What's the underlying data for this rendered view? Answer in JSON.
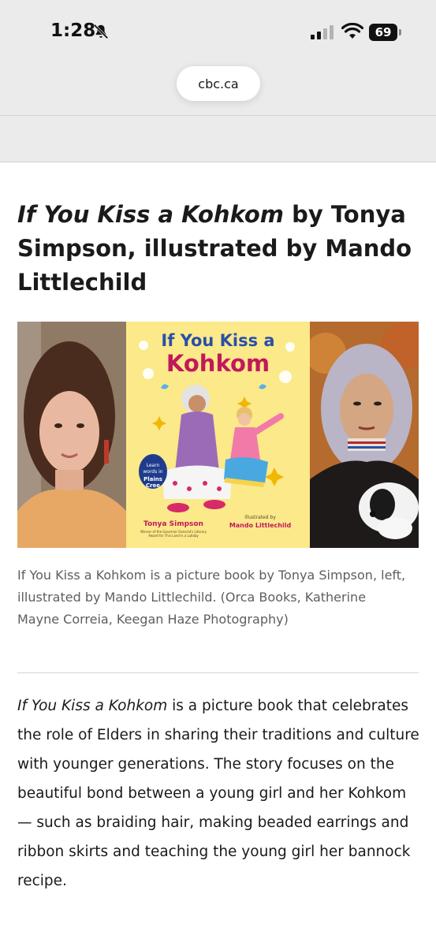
{
  "status_bar": {
    "time": "1:28",
    "battery_level": "69",
    "icons": [
      "bell-slash-icon",
      "cellular-signal-icon",
      "wifi-icon",
      "battery-icon"
    ]
  },
  "browser": {
    "url": "cbc.ca"
  },
  "article": {
    "headline_italic": "If You Kiss a Kohkom",
    "headline_rest": " by Tonya Simpson, illustrated by Mando Littlechild",
    "image": {
      "cover_title_line1": "If You Kiss a",
      "cover_title_line2": "Kohkom",
      "cover_badge": "Learn words in Plains Cree",
      "cover_author": "Tonya Simpson",
      "cover_author_note": "Winner of the Governor General's Literary Award for This Land Is a Lullaby",
      "cover_illustrator_label": "illustrated by",
      "cover_illustrator": "Mando Littlechild"
    },
    "caption": "If You Kiss a Kohkom is a picture book by Tonya Simpson, left, illustrated by Mando Littlechild. (Orca Books, Katherine Mayne Correia, Keegan Haze Photography)",
    "body_italic": "If You Kiss a Kohkom",
    "body_rest": " is a picture book that celebrates the role of Elders in sharing their traditions and culture with younger generations. The story focuses on the beautiful bond between a young girl and her Kohkom — such as braiding hair, making beaded earrings and ribbon skirts and teaching the young girl her bannock recipe."
  },
  "colors": {
    "chrome_background": "#ebebeb",
    "cover_background": "#fbe98a",
    "cover_title_blue": "#2a4fa8",
    "cover_title_pink": "#c2185b",
    "caption_gray": "#5e5e5e"
  }
}
